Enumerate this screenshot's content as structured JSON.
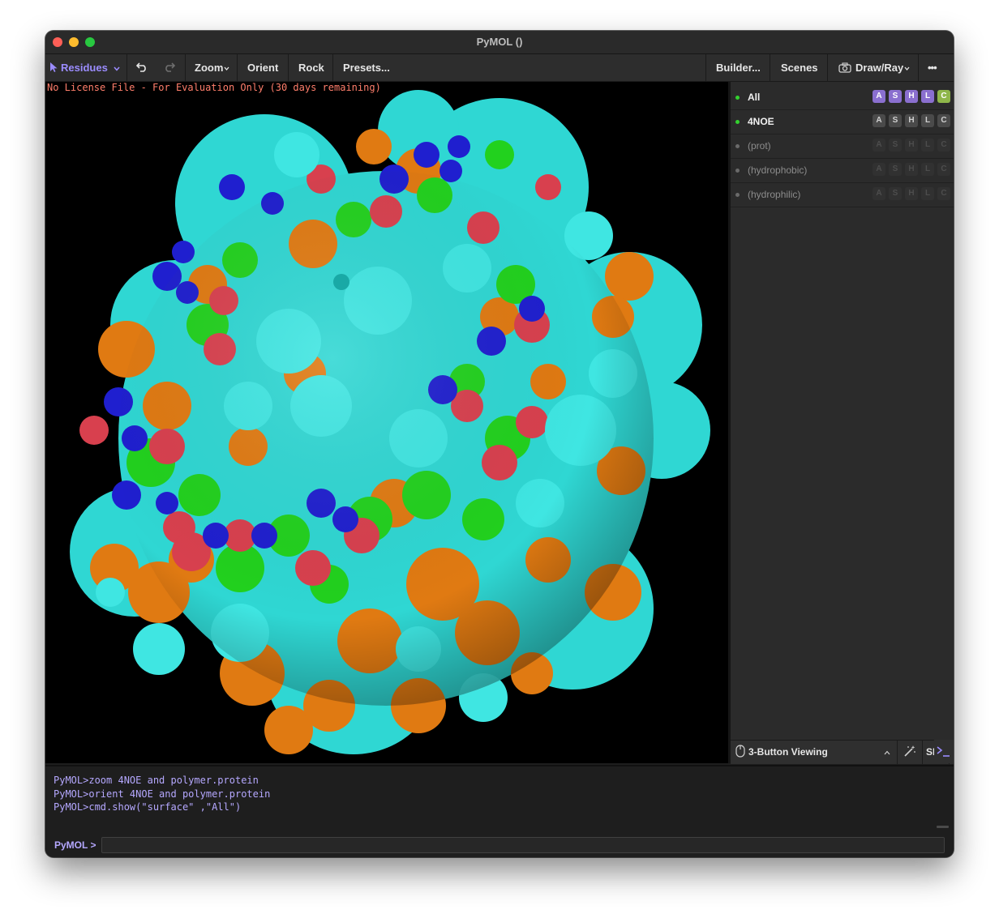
{
  "window": {
    "title": "PyMOL ()"
  },
  "toolbar": {
    "mode_label": "Residues",
    "zoom_label": "Zoom",
    "orient_label": "Orient",
    "rock_label": "Rock",
    "presets_label": "Presets...",
    "builder_label": "Builder...",
    "scenes_label": "Scenes",
    "drawray_label": "Draw/Ray",
    "more_label": "•••"
  },
  "viewport": {
    "license_text": "No License File - For Evaluation Only (30 days remaining)",
    "surface_colors": {
      "background": "#000000",
      "cyan": "#2fd7d3",
      "orange": "#e07a12",
      "green": "#22d11e",
      "red": "#d8404e",
      "blue": "#1f1fcf"
    }
  },
  "objects": [
    {
      "name": "All",
      "buttons": [
        "A",
        "S",
        "H",
        "L",
        "C"
      ],
      "active": true
    },
    {
      "name": "4NOE",
      "buttons": [
        "A",
        "S",
        "H",
        "L",
        "C"
      ],
      "active": true
    },
    {
      "name": "(prot)",
      "buttons": [
        "A",
        "S",
        "H",
        "L",
        "C"
      ],
      "active": false
    },
    {
      "name": "(hydrophobic)",
      "buttons": [
        "A",
        "S",
        "H",
        "L",
        "C"
      ],
      "active": false
    },
    {
      "name": "(hydrophilic)",
      "buttons": [
        "A",
        "S",
        "H",
        "L",
        "C"
      ],
      "active": false
    }
  ],
  "bottombar": {
    "mouse_mode_label": "3-Button Viewing",
    "seq_label": "SEQ"
  },
  "console": {
    "log": [
      "PyMOL>zoom 4NOE and polymer.protein",
      "PyMOL>orient 4NOE and polymer.protein",
      "PyMOL>cmd.show(\"surface\"   ,\"All\")"
    ],
    "prompt_label": "PyMOL >",
    "input_value": ""
  }
}
